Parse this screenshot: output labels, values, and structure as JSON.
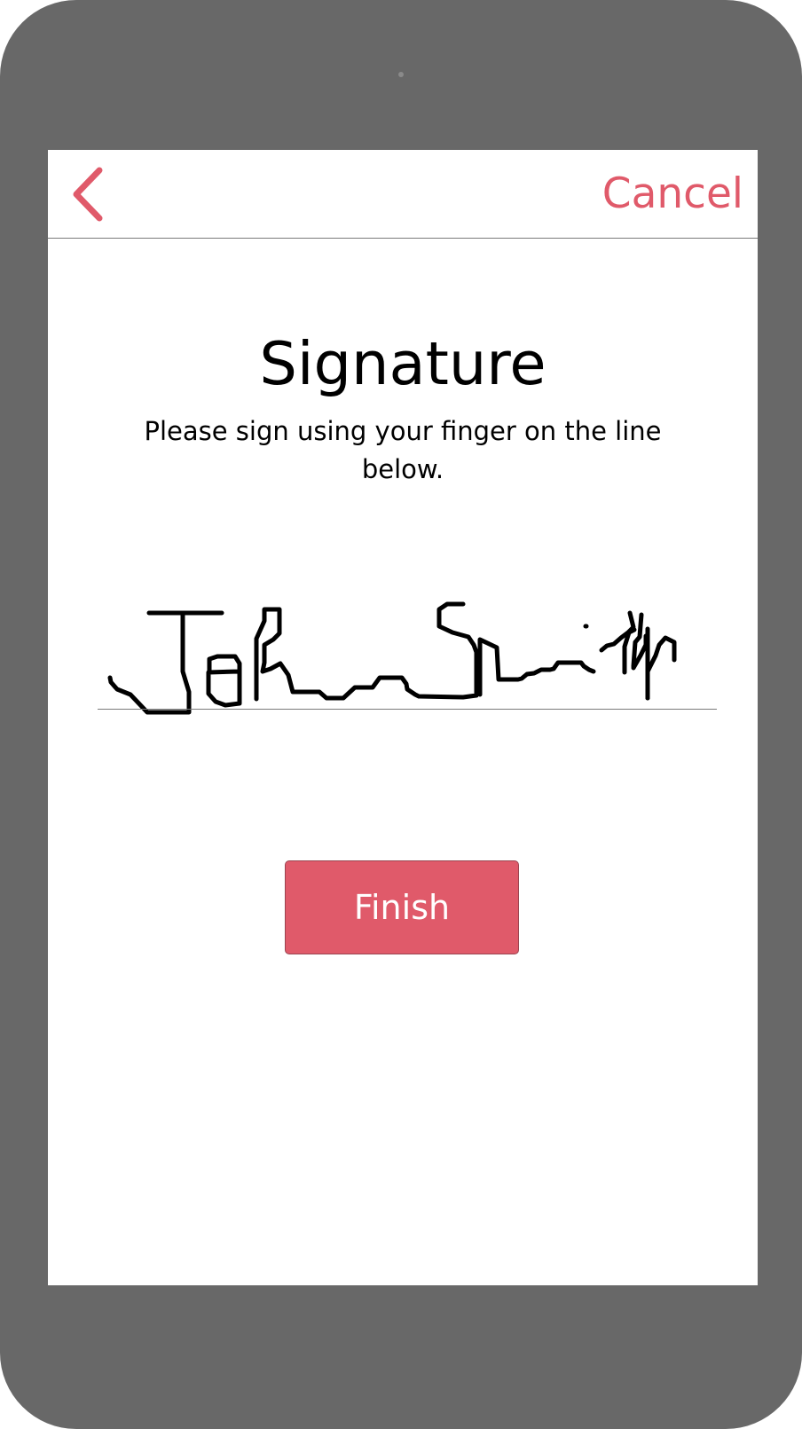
{
  "nav": {
    "back_icon": "chevron-left-icon",
    "cancel_label": "Cancel"
  },
  "main": {
    "title": "Signature",
    "instructions": "Please sign using your finger on the line below."
  },
  "signature": {
    "text": "John Smith"
  },
  "actions": {
    "finish_label": "Finish"
  },
  "colors": {
    "accent": "#e05a6a",
    "device_frame": "#686868",
    "screen_background": "#ffffff",
    "divider": "#7a7a7a",
    "ink": "#000000"
  }
}
